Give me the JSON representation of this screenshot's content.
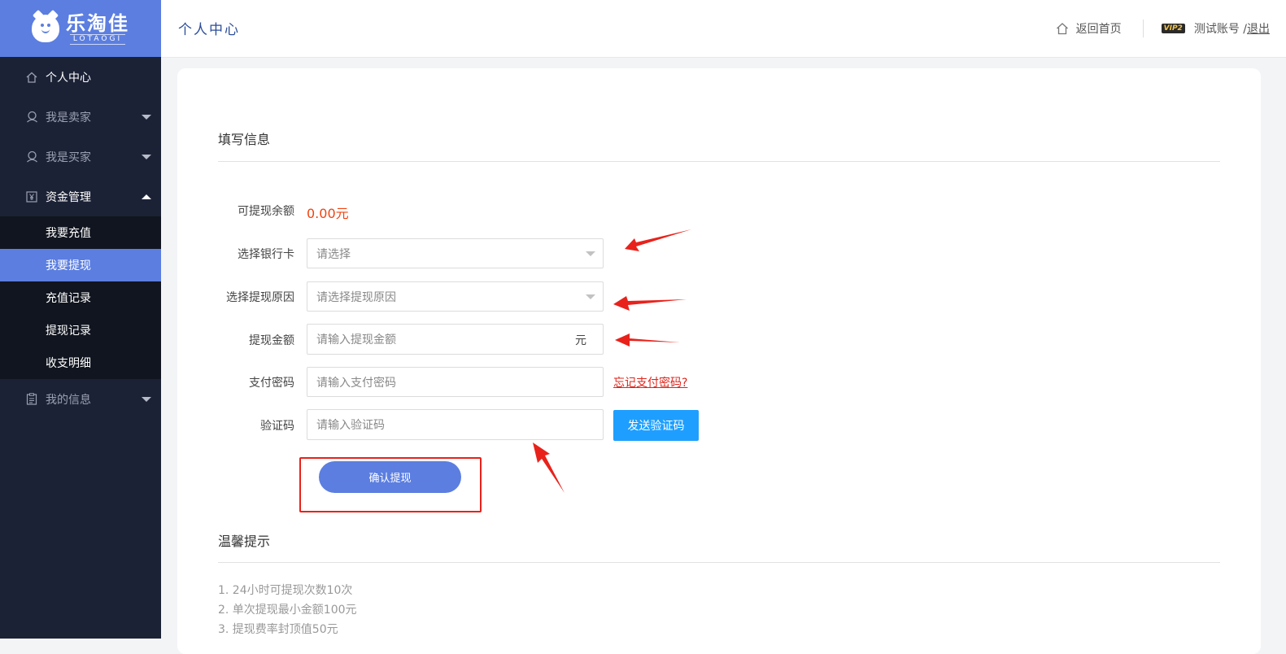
{
  "brand": {
    "name_cn": "乐淘佳",
    "name_en": "LOTAOGI"
  },
  "sidebar": {
    "items": [
      {
        "label": "个人中心",
        "icon": "home-icon"
      },
      {
        "label": "我是卖家",
        "icon": "user-icon"
      },
      {
        "label": "我是买家",
        "icon": "user-icon"
      },
      {
        "label": "资金管理",
        "icon": "yen-icon"
      },
      {
        "label": "我的信息",
        "icon": "clipboard-icon"
      }
    ],
    "submenu": [
      "我要充值",
      "我要提现",
      "充值记录",
      "提现记录",
      "收支明细"
    ],
    "selected_submenu": "我要提现"
  },
  "header": {
    "title": "个人中心",
    "home_link": "返回首页",
    "vip_badge": "VIP2",
    "account": "测试账号 /",
    "logout": "退出"
  },
  "form": {
    "section_title": "填写信息",
    "balance_label": "可提现余额",
    "balance_value": "0.00元",
    "bank_label": "选择银行卡",
    "bank_placeholder": "请选择",
    "reason_label": "选择提现原因",
    "reason_placeholder": "请选择提现原因",
    "amount_label": "提现金额",
    "amount_placeholder": "请输入提现金额",
    "amount_unit": "元",
    "password_label": "支付密码",
    "password_placeholder": "请输入支付密码",
    "forgot_password": "忘记支付密码?",
    "code_label": "验证码",
    "code_placeholder": "请输入验证码",
    "send_code": "发送验证码",
    "confirm": "确认提现"
  },
  "tips": {
    "title": "温馨提示",
    "items": [
      "1. 24小时可提现次数10次",
      "2. 单次提现最小金额100元",
      "3. 提现费率封顶值50元"
    ]
  },
  "colors": {
    "primary": "#5b7ee0",
    "sidebar_bg": "#1c2236",
    "accent_red": "#e8221b",
    "balance": "#f0430f",
    "sms_button": "#1e9fff"
  }
}
